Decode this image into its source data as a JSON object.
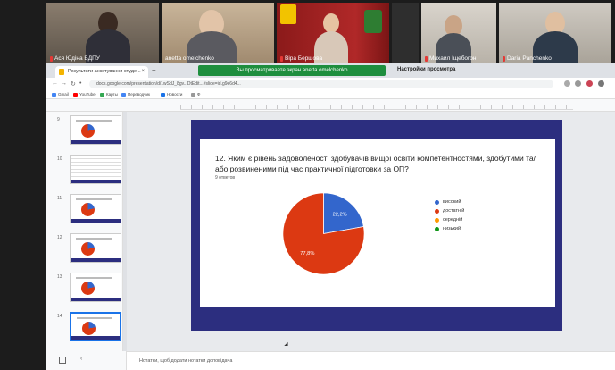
{
  "participants": [
    {
      "name": "Ася Юдіна БДПУ"
    },
    {
      "name": "anetta omelchenko"
    },
    {
      "name": "Віра Бершова"
    },
    {
      "name": ""
    },
    {
      "name": "Михаил Іщебогон"
    },
    {
      "name": "Daria Panchenko"
    }
  ],
  "share": {
    "banner_text": "Вы просматриваете экран  anetta omelchenko",
    "settings_label": "Настройки просмотра"
  },
  "browser": {
    "tab_title": "Результати анкетування студе...",
    "url": "docs.google.com/presentation/d/1wSdJ_8gv...DtEdit...#slide=id.g9e6d4...",
    "bookmarks": [
      "Gmail",
      "YouTube",
      "Карты",
      "Переводчик",
      "Новости",
      "Ф"
    ]
  },
  "filmstrip": {
    "slides": [
      "9",
      "10",
      "11",
      "12",
      "13",
      "14"
    ]
  },
  "slide": {
    "question": "12. Яким є рівень задоволеності здобувачів вищої освіти компетентностями, здобутими та/або розвиненими під час практичної підготовки за ОП?",
    "responses": "9 ответов"
  },
  "chart_data": {
    "type": "pie",
    "categories": [
      "високий",
      "достатній",
      "середній",
      "низький"
    ],
    "values": [
      22.2,
      77.8,
      0,
      0
    ],
    "labels": [
      "22,2%",
      "77,8%",
      "",
      ""
    ],
    "colors": [
      "#3366cc",
      "#dc3912",
      "#ff9900",
      "#109618"
    ]
  },
  "notes": {
    "placeholder": "Нотатки, щоб додати нотатки доповідача"
  }
}
